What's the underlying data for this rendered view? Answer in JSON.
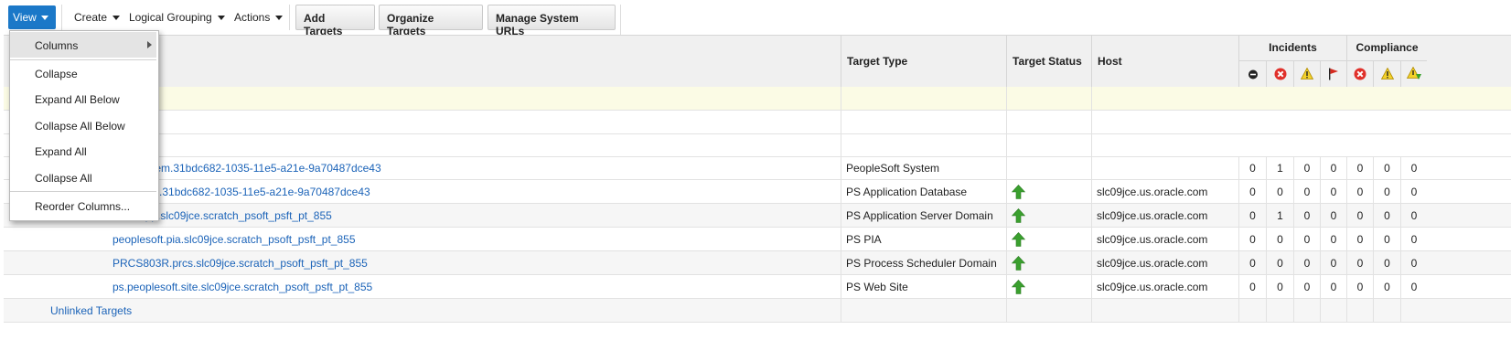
{
  "toolbar": {
    "view_label": "View",
    "create_label": "Create",
    "logical_grouping_label": "Logical Grouping",
    "actions_label": "Actions",
    "add_targets_label": "Add Targets",
    "organize_targets_label": "Organize Targets",
    "manage_system_urls_label": "Manage System URLs"
  },
  "view_menu": {
    "items": [
      {
        "label": "Columns",
        "has_submenu": true
      },
      {
        "label": "Collapse"
      },
      {
        "label": "Expand All Below"
      },
      {
        "label": "Collapse All Below"
      },
      {
        "label": "Expand All"
      },
      {
        "label": "Collapse All"
      },
      {
        "label": "Reorder Columns..."
      }
    ]
  },
  "table": {
    "columns": {
      "target_type": "Target Type",
      "target_status": "Target Status",
      "host": "Host",
      "incidents": "Incidents",
      "compliance": "Compliance"
    },
    "incident_icons": [
      "minus-circle-icon",
      "critical-x-icon",
      "warning-icon",
      "flag-icon"
    ],
    "compliance_icons": [
      "critical-x-icon",
      "warning-icon",
      "warning-down-icon"
    ],
    "rows": [
      {
        "name": "ssystem.31bdc682-1035-11e5-a21e-9a70487dce43",
        "type": "PeopleSoft System",
        "status": "",
        "host": "",
        "counts": [
          "0",
          "1",
          "0",
          "0",
          "0",
          "0",
          "0"
        ]
      },
      {
        "name": "R1.db.31bdc682-1035-11e5-a21e-9a70487dce43",
        "type": "PS Application Database",
        "status": "up",
        "host": "slc09jce.us.oracle.com",
        "counts": [
          "0",
          "0",
          "0",
          "0",
          "0",
          "0",
          "0"
        ]
      },
      {
        "name": "1.app.slc09jce.scratch_psoft_psft_pt_855",
        "type": "PS Application Server Domain",
        "status": "up",
        "host": "slc09jce.us.oracle.com",
        "counts": [
          "0",
          "1",
          "0",
          "0",
          "0",
          "0",
          "0"
        ]
      },
      {
        "name": "peoplesoft.pia.slc09jce.scratch_psoft_psft_pt_855",
        "type": "PS PIA",
        "status": "up",
        "host": "slc09jce.us.oracle.com",
        "counts": [
          "0",
          "0",
          "0",
          "0",
          "0",
          "0",
          "0"
        ]
      },
      {
        "name": "PRCS803R.prcs.slc09jce.scratch_psoft_psft_pt_855",
        "type": "PS Process Scheduler Domain",
        "status": "up",
        "host": "slc09jce.us.oracle.com",
        "counts": [
          "0",
          "0",
          "0",
          "0",
          "0",
          "0",
          "0"
        ]
      },
      {
        "name": "ps.peoplesoft.site.slc09jce.scratch_psoft_psft_pt_855",
        "type": "PS Web Site",
        "status": "up",
        "host": "slc09jce.us.oracle.com",
        "counts": [
          "0",
          "0",
          "0",
          "0",
          "0",
          "0",
          "0"
        ]
      },
      {
        "name": "Unlinked Targets",
        "type": "",
        "status": "",
        "host": "",
        "counts": [
          "",
          "",
          "",
          "",
          "",
          "",
          ""
        ]
      }
    ]
  },
  "colors": {
    "accent": "#1b78c8",
    "link": "#1b63b8",
    "status_up": "#3aa02e"
  }
}
